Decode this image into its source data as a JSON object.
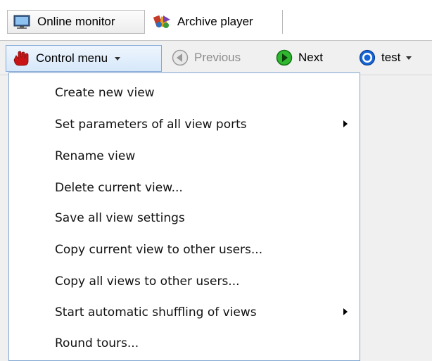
{
  "tabs": {
    "online_monitor": "Online monitor",
    "archive_player": "Archive player"
  },
  "toolbar": {
    "control_menu": "Control menu",
    "previous": "Previous",
    "next": "Next",
    "test": "test"
  },
  "menu": {
    "items": [
      {
        "label": "Create new view",
        "submenu": false
      },
      {
        "label": "Set parameters of all view ports",
        "submenu": true
      },
      {
        "label": "Rename view",
        "submenu": false
      },
      {
        "label": "Delete current view...",
        "submenu": false
      },
      {
        "label": "Save all view settings",
        "submenu": false
      },
      {
        "label": "Copy current view to other users...",
        "submenu": false
      },
      {
        "label": "Copy all views to other users...",
        "submenu": false
      },
      {
        "label": "Start automatic shuffling of views",
        "submenu": true
      },
      {
        "label": "Round tours...",
        "submenu": false
      }
    ]
  },
  "colors": {
    "accent_border": "#7fa6d1",
    "control_menu_bg": "#d6e8fa",
    "next_icon": "#1ea01e",
    "test_icon": "#1565d8",
    "hand_icon": "#c81414"
  },
  "icons": {
    "online_monitor": "monitor-icon",
    "archive_player": "archive-player-icon",
    "control_menu": "red-hand-icon",
    "previous": "previous-arrow-icon",
    "next": "next-arrow-icon",
    "test": "radio-circle-icon"
  }
}
